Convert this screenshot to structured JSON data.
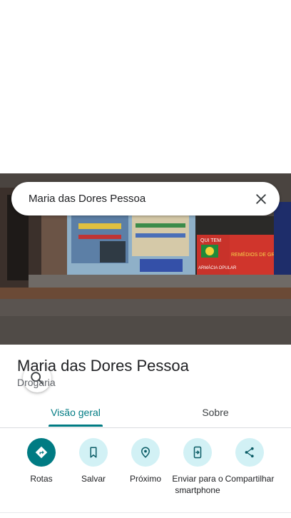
{
  "search": {
    "value": "Maria das Dores Pessoa"
  },
  "place": {
    "name": "Maria das Dores Pessoa",
    "category": "Drogaria"
  },
  "tabs": [
    {
      "label": "Visão geral",
      "active": true
    },
    {
      "label": "Sobre",
      "active": false
    }
  ],
  "actions": [
    {
      "label": "Rotas",
      "icon": "directions-icon"
    },
    {
      "label": "Salvar",
      "icon": "bookmark-icon"
    },
    {
      "label": "Próximo",
      "icon": "nearby-icon"
    },
    {
      "label": "Enviar para o smartphone",
      "icon": "send-to-phone-icon"
    },
    {
      "label": "Compartilhar",
      "icon": "share-icon"
    }
  ],
  "photo_signs": {
    "left_panel": "QUI TEM",
    "left_panel_bottom": "ARMÁCIA OPULAR",
    "right_panel": "REMÉDIOS DE GRAÇA"
  },
  "colors": {
    "accent": "#007b83",
    "chip_bg": "#d2f1f5"
  }
}
